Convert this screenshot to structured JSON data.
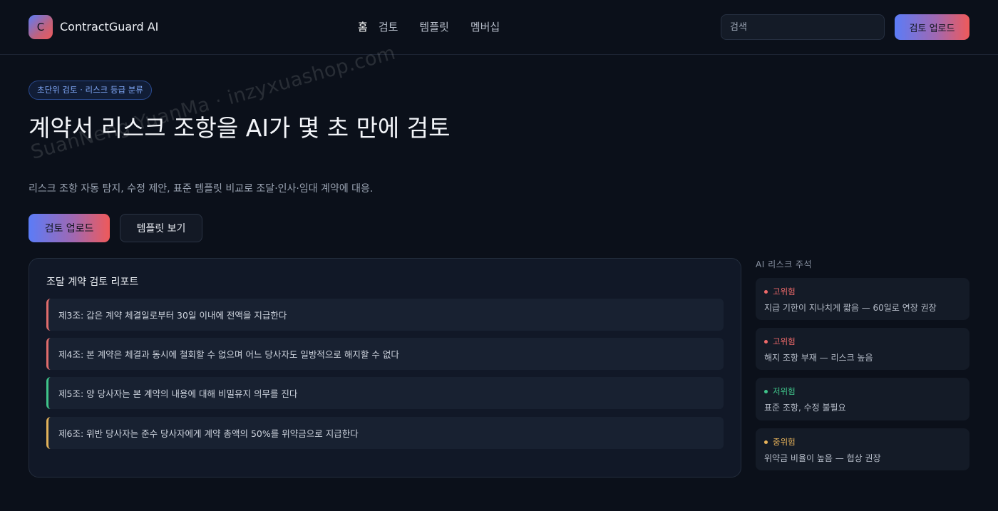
{
  "header": {
    "logo_letter": "C",
    "brand": "ContractGuard AI",
    "nav": [
      "홈",
      "검토",
      "템플릿",
      "멤버십"
    ],
    "search_placeholder": "검색",
    "upload_label": "검토 업로드"
  },
  "hero": {
    "pill": "초단위 검토 · 리스크 등급 분류",
    "title": "계약서 리스크 조항을 AI가 몇 초 만에 검토",
    "subtitle": "리스크 조항 자동 탐지, 수정 제안, 표준 템플릿 비교로 조달·인사·임대 계약에 대응.",
    "primary_button": "검토 업로드",
    "secondary_button": "템플릿 보기"
  },
  "report": {
    "title": "조달 계약 검토 리포트",
    "clauses": [
      {
        "text": "제3조: 갑은 계약 체결일로부터 30일 이내에 전액을 지급한다",
        "color": "#e06c6c"
      },
      {
        "text": "제4조: 본 계약은 체결과 동시에 철회할 수 없으며 어느 당사자도 일방적으로 해지할 수 없다",
        "color": "#e06c6c"
      },
      {
        "text": "제5조: 양 당사자는 본 계약의 내용에 대해 비밀유지 의무를 진다",
        "color": "#3fc48a"
      },
      {
        "text": "제6조: 위반 당사자는 준수 당사자에게 계약 총액의 50%를 위약금으로 지급한다",
        "color": "#e2b25a"
      }
    ]
  },
  "annotations": {
    "heading": "AI 리스크 주석",
    "items": [
      {
        "level": "고위험",
        "color": "#f06a6a",
        "note": "지급 기한이 지나치게 짧음 — 60일로 연장 권장"
      },
      {
        "level": "고위험",
        "color": "#f06a6a",
        "note": "해지 조항 부재 — 리스크 높음"
      },
      {
        "level": "저위험",
        "color": "#3fc48a",
        "note": "표준 조항, 수정 불필요"
      },
      {
        "level": "중위험",
        "color": "#e8b35a",
        "note": "위약금 비율이 높음 — 협상 권장"
      }
    ]
  },
  "watermark": "SuanNeng YuanMa · inzyxuashop.com"
}
